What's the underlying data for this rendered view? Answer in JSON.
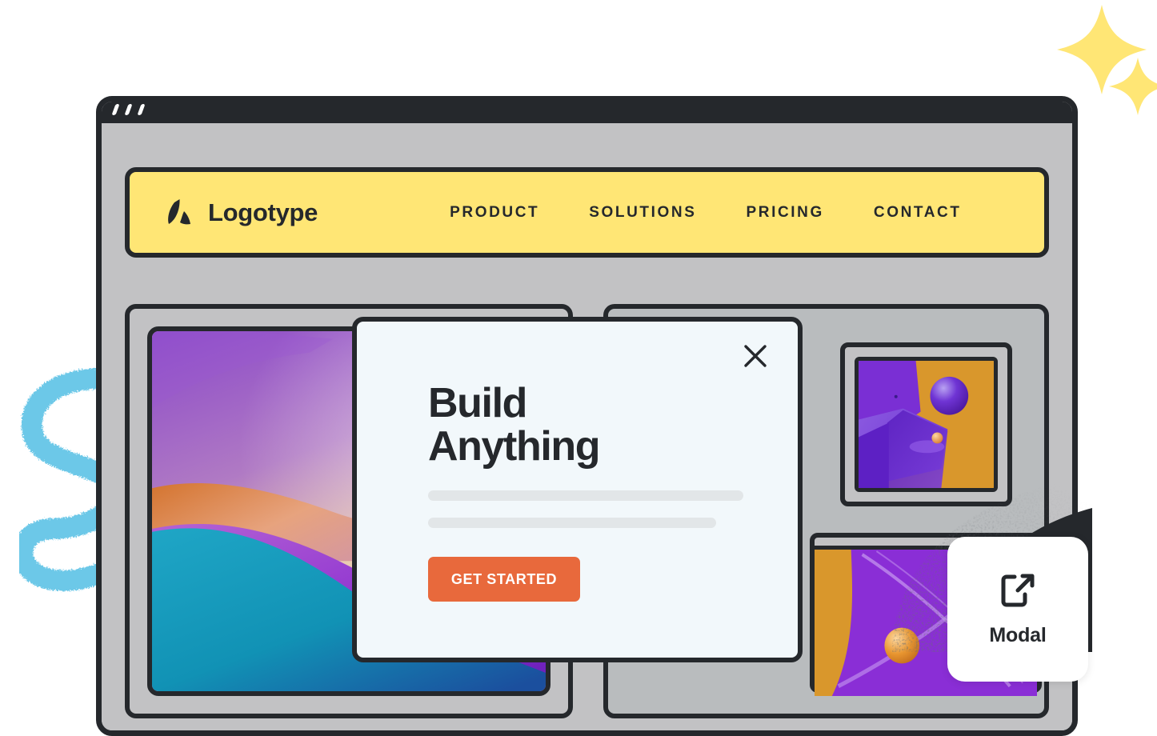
{
  "window": {
    "title_bar_dots": 3
  },
  "navbar": {
    "brand_name": "Logotype",
    "brand_icon": "mountain-logo-icon",
    "links": [
      {
        "label": "PRODUCT"
      },
      {
        "label": "SOLUTIONS"
      },
      {
        "label": "PRICING"
      },
      {
        "label": "CONTACT"
      }
    ]
  },
  "modal": {
    "title": "Build\nAnything",
    "close_icon": "close-x-icon",
    "skeleton_lines": 2,
    "cta_label": "GET STARTED"
  },
  "badge": {
    "icon": "external-link-icon",
    "label": "Modal"
  },
  "colors": {
    "accent_yellow": "#ffe675",
    "dark": "#25282c",
    "panel_gray": "#c2c2c4",
    "modal_bg": "#f2f8fb",
    "cta_orange": "#e8693c",
    "skeleton_gray": "#e2e6e8",
    "sparkle_yellow": "#ffe675",
    "squiggle_blue": "#6cc8e8",
    "art_purple": "#7b2fd4",
    "art_orange": "#d9972c"
  },
  "decor": {
    "sparkle_large": "sparkle-icon",
    "sparkle_small": "sparkle-icon",
    "squiggle": "squiggle-shape"
  }
}
